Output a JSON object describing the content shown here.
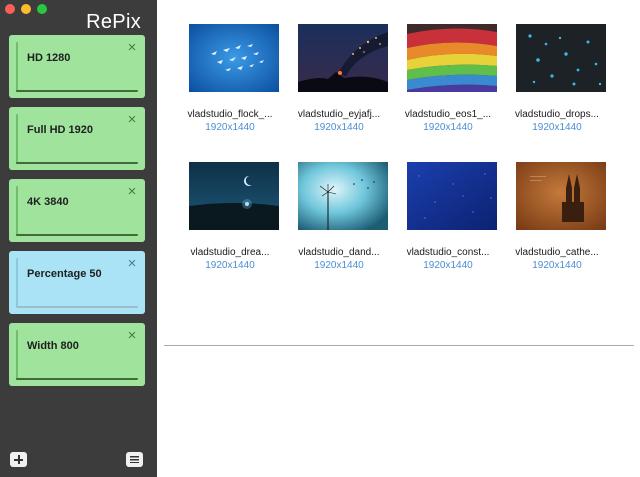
{
  "window": {
    "title": "RePix",
    "traffic_lights": {
      "close": "#fc5f57",
      "minimize": "#fdbc2e",
      "zoom": "#28c840"
    }
  },
  "sidebar": {
    "background": "#3c3c3c",
    "presets": [
      {
        "label": "HD 1280",
        "color": "#9fe39c",
        "selected": false,
        "close_icon": "close-icon"
      },
      {
        "label": "Full HD 1920",
        "color": "#9fe39c",
        "selected": false,
        "close_icon": "close-icon"
      },
      {
        "label": "4K 3840",
        "color": "#9fe39c",
        "selected": false,
        "close_icon": "close-icon"
      },
      {
        "label": "Percentage 50",
        "color": "#a9e3f5",
        "selected": true,
        "close_icon": "close-icon"
      },
      {
        "label": "Width 800",
        "color": "#9fe39c",
        "selected": false,
        "close_icon": "close-icon"
      }
    ],
    "footer": {
      "add_icon": "plus-icon",
      "menu_icon": "menu-icon"
    }
  },
  "images": [
    {
      "name": "vladstudio_flock_...",
      "size": "1920x1440"
    },
    {
      "name": "vladstudio_eyjafj...",
      "size": "1920x1440"
    },
    {
      "name": "vladstudio_eos1_...",
      "size": "1920x1440"
    },
    {
      "name": "vladstudio_drops...",
      "size": "1920x1440"
    },
    {
      "name": "vladstudio_drea...",
      "size": "1920x1440"
    },
    {
      "name": "vladstudio_dand...",
      "size": "1920x1440"
    },
    {
      "name": "vladstudio_const...",
      "size": "1920x1440"
    },
    {
      "name": "vladstudio_cathe...",
      "size": "1920x1440"
    }
  ]
}
